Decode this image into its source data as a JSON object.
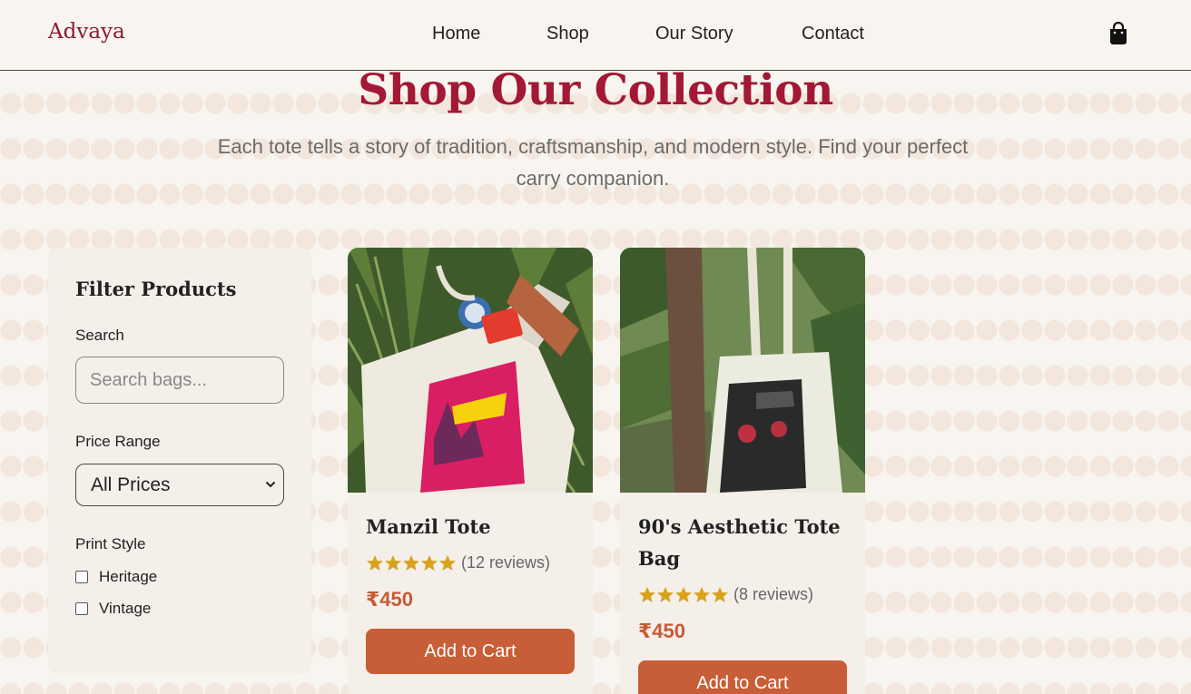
{
  "brand": {
    "name": "Advaya",
    "color": "#8b1a2e"
  },
  "nav": {
    "links": [
      {
        "label": "Home"
      },
      {
        "label": "Shop"
      },
      {
        "label": "Our Story"
      },
      {
        "label": "Contact"
      }
    ],
    "cart_icon": "shopping-bag-icon"
  },
  "hero": {
    "title": "Shop Our Collection",
    "subtitle": "Each tote tells a story of tradition, craftsmanship, and modern style. Find your perfect carry companion."
  },
  "filters": {
    "title": "Filter Products",
    "search_label": "Search",
    "search_placeholder": "Search bags...",
    "search_value": "",
    "price_label": "Price Range",
    "price_selected": "All Prices",
    "print_label": "Print Style",
    "print_options": [
      {
        "label": "Heritage",
        "checked": false
      },
      {
        "label": "Vintage",
        "checked": false
      }
    ]
  },
  "products": [
    {
      "name": "Manzil Tote",
      "rating": 5,
      "reviews": "(12 reviews)",
      "price": "₹450",
      "button": "Add to Cart"
    },
    {
      "name": "90's Aesthetic Tote Bag",
      "rating": 5,
      "reviews": "(8 reviews)",
      "price": "₹450",
      "button": "Add to Cart"
    }
  ],
  "colors": {
    "accent": "#a21835",
    "button": "#c85e37",
    "price": "#c85a35",
    "star": "#d9a21b",
    "background": "#f8f4ef"
  }
}
